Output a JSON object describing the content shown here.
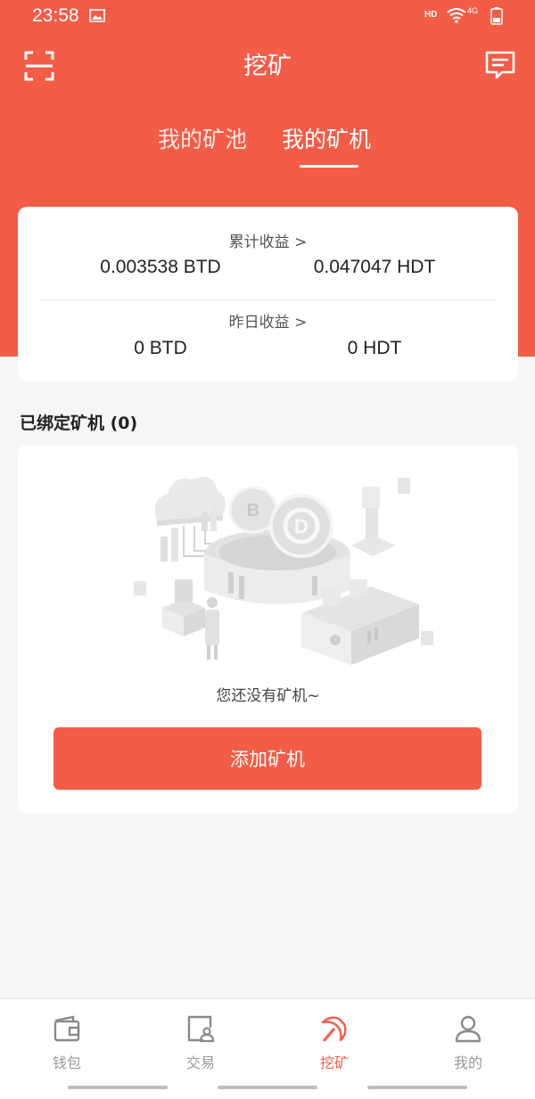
{
  "status_bar": {
    "time": "23:58",
    "hd": "HD",
    "network": "4G"
  },
  "header": {
    "title": "挖矿"
  },
  "tabs": [
    {
      "label": "我的矿池",
      "active": false
    },
    {
      "label": "我的矿机",
      "active": true
    }
  ],
  "earnings": {
    "total_label": "累计收益 >",
    "total_btd": "0.003538 BTD",
    "total_hdt": "0.047047 HDT",
    "yesterday_label": "昨日收益 >",
    "yesterday_btd": "0 BTD",
    "yesterday_hdt": "0 HDT"
  },
  "bound_miners": {
    "title": "已绑定矿机 (0)",
    "empty_text": "您还没有矿机~",
    "add_button": "添加矿机"
  },
  "bottom_nav": [
    {
      "label": "钱包",
      "icon": "wallet-icon",
      "active": false
    },
    {
      "label": "交易",
      "icon": "trade-icon",
      "active": false
    },
    {
      "label": "挖矿",
      "icon": "pickaxe-icon",
      "active": true
    },
    {
      "label": "我的",
      "icon": "person-icon",
      "active": false
    }
  ],
  "colors": {
    "accent": "#f35c46",
    "background": "#f6f6f6",
    "card": "#ffffff"
  }
}
